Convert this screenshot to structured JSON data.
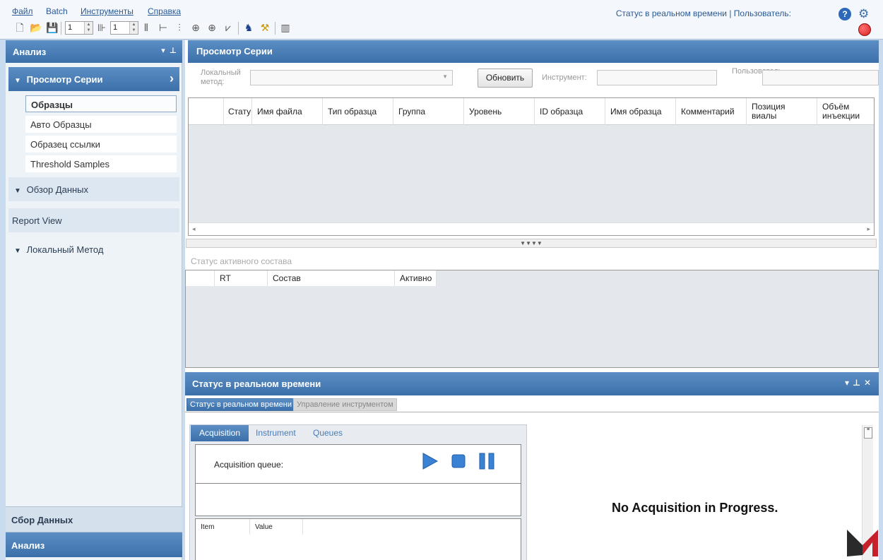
{
  "menu": {
    "items": [
      "Файл",
      "Batch",
      "Инструменты",
      "Справка"
    ],
    "status_text": "Статус в реальном времени | Пользователь:"
  },
  "toolbar": {
    "spin1_value": "1",
    "spin2_value": "1"
  },
  "left_panel": {
    "title": "Анализ",
    "sections": {
      "batch_view": "Просмотр Серии",
      "data_review": "Обзор Данных",
      "report_view": "Report View",
      "local_method": "Локальный Метод"
    },
    "sub_items": [
      "Образцы",
      "Авто Образцы",
      "Образец ссылки",
      "Threshold Samples"
    ],
    "bottom": {
      "acquisition": "Сбор Данных",
      "analysis": "Анализ"
    }
  },
  "batch_view": {
    "title": "Просмотр Серии",
    "filters": {
      "local_method_label": "Локальный метод:",
      "refresh_button": "Обновить",
      "instrument_label": "Инструмент:",
      "user_label": "Пользователь"
    },
    "columns": [
      "Стату",
      "Имя файла",
      "Тип образца",
      "Группа",
      "Уровень",
      "ID образца",
      "Имя образца",
      "Комментарий",
      "Позиция виалы",
      "Объём инъекции"
    ]
  },
  "compound_status": {
    "title": "Статус активного состава",
    "columns": [
      "RT",
      "Состав",
      "Активно"
    ]
  },
  "realtime": {
    "title": "Статус в реальном времени",
    "tabs": [
      "Статус в реальном времени",
      "Управление инструментом"
    ],
    "sub_tabs": [
      "Acquisition",
      "Instrument",
      "Queues"
    ],
    "acq_queue_label": "Acquisition queue:",
    "kv_columns": [
      "Item",
      "Value"
    ],
    "no_acquisition": "No Acquisition in Progress."
  },
  "colors": {
    "header_blue": "#3c70aa",
    "accent_red": "#d82020",
    "help_blue": "#2e68b8",
    "logo_red": "#c8202a",
    "logo_dark": "#2a2a2a"
  }
}
